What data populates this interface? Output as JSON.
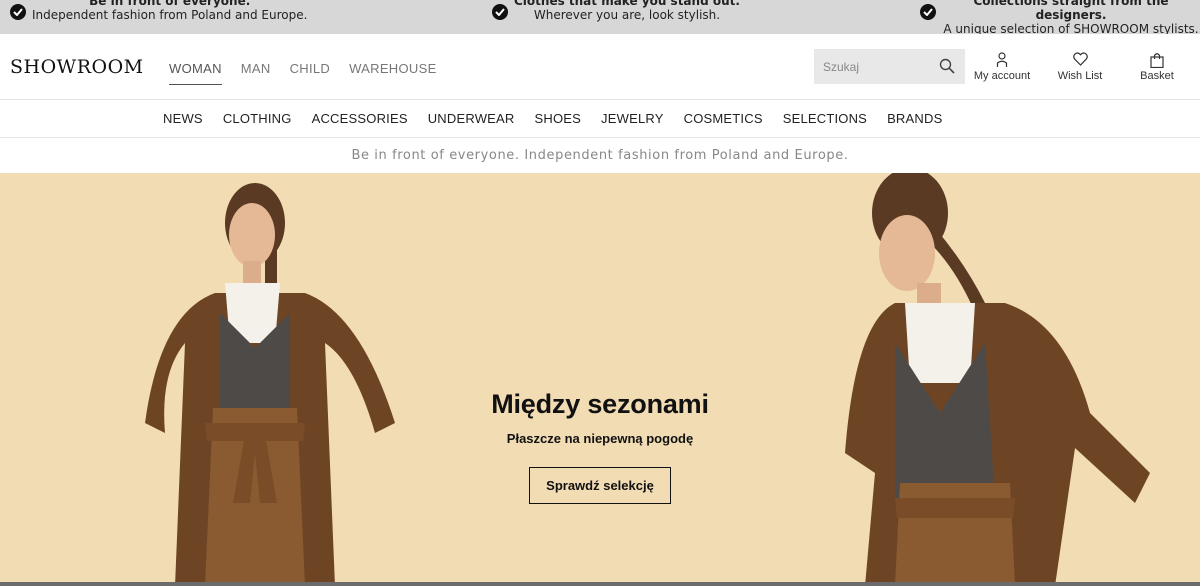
{
  "promos": [
    {
      "title": "Be in front of everyone.",
      "text": "Independent fashion from Poland and Europe."
    },
    {
      "title": "Clothes that make you stand out.",
      "text": "Wherever you are, look stylish."
    },
    {
      "title": "Collections straight from the designers.",
      "text": "A unique selection of SHOWROOM stylists."
    }
  ],
  "header": {
    "logo": "SHOWROOM",
    "gender_nav": [
      "WOMAN",
      "MAN",
      "CHILD",
      "WAREHOUSE"
    ],
    "search_placeholder": "Szukaj",
    "account_label": "My account",
    "wishlist_label": "Wish List",
    "basket_label": "Basket"
  },
  "categories": [
    "NEWS",
    "CLOTHING",
    "ACCESSORIES",
    "UNDERWEAR",
    "SHOES",
    "JEWELRY",
    "COSMETICS",
    "SELECTIONS",
    "BRANDS"
  ],
  "tagline": "Be in front of everyone. Independent fashion from Poland and Europe.",
  "hero": {
    "title": "Między sezonami",
    "subtitle": "Płaszcze na niepewną pogodę",
    "button_label": "Sprawdź selekcję"
  },
  "colors": {
    "promo_bg": "#d7d7d7",
    "hero_bg": "#f2dcb4",
    "coat": "#6e4524",
    "cardigan": "#4e4a47",
    "trousers": "#8a5a30"
  },
  "icons": [
    "check-icon",
    "search-icon",
    "user-icon",
    "heart-icon",
    "bag-icon"
  ]
}
